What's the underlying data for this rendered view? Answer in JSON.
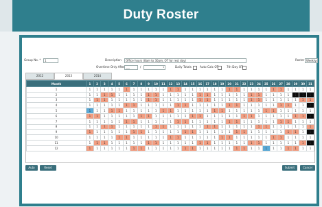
{
  "app": {
    "title": "Duty Roster"
  },
  "form": {
    "group_label": "Group No. *",
    "group_value": "1",
    "description_label": "Description",
    "description_value": "Office hours (8am to 30pm, OT for rest day)",
    "roster_label": "Roster",
    "roster_value": "Weekly",
    "overtime_label": "Overtime Only After",
    "overtime_hours": "___",
    "overtime_sep": "/",
    "daily_totals_label": "Daily Totals",
    "auto_calc_label": "Auto Calc OT",
    "seventh_day_label": "7th Day OT"
  },
  "tabs": [
    "2012",
    "2013",
    "2014"
  ],
  "active_tab": "2013",
  "grid": {
    "month_header": "Month",
    "days": [
      "1",
      "2",
      "3",
      "4",
      "5",
      "6",
      "7",
      "8",
      "9",
      "10",
      "11",
      "12",
      "13",
      "14",
      "15",
      "16",
      "17",
      "18",
      "19",
      "20",
      "21",
      "22",
      "23",
      "24",
      "25",
      "26",
      "27",
      "28",
      "29",
      "30",
      "31"
    ],
    "rows": [
      {
        "month": "1",
        "s": [
          6,
          12,
          13,
          20,
          21,
          26,
          27
        ],
        "b": [],
        "k": []
      },
      {
        "month": "2",
        "s": [
          3,
          4,
          9,
          10,
          16,
          17,
          23,
          24
        ],
        "b": [],
        "k": [
          29,
          30,
          31
        ]
      },
      {
        "month": "3",
        "s": [
          2,
          3,
          9,
          10,
          16,
          17,
          23,
          24,
          30,
          31
        ],
        "b": [],
        "k": []
      },
      {
        "month": "4",
        "s": [
          6,
          7,
          13,
          14,
          20,
          21,
          27,
          28
        ],
        "b": [],
        "k": [
          31
        ]
      },
      {
        "month": "5",
        "s": [
          4,
          5,
          11,
          12,
          18,
          19,
          25,
          26
        ],
        "b": [
          1
        ],
        "k": []
      },
      {
        "month": "6",
        "s": [
          1,
          2,
          8,
          9,
          15,
          16,
          22,
          23,
          29,
          30
        ],
        "b": [],
        "k": [
          31
        ]
      },
      {
        "month": "7",
        "s": [
          6,
          7,
          13,
          14,
          20,
          21,
          27,
          28
        ],
        "b": [],
        "k": []
      },
      {
        "month": "8",
        "s": [
          3,
          4,
          10,
          11,
          17,
          18,
          24,
          25,
          31
        ],
        "b": [],
        "k": []
      },
      {
        "month": "9",
        "s": [
          1,
          7,
          8,
          14,
          15,
          21,
          22,
          28,
          29
        ],
        "b": [],
        "k": [
          31
        ]
      },
      {
        "month": "10",
        "s": [
          5,
          6,
          12,
          13,
          19,
          20,
          26,
          27
        ],
        "b": [],
        "k": []
      },
      {
        "month": "11",
        "s": [
          2,
          3,
          9,
          10,
          16,
          17,
          23,
          24,
          30
        ],
        "b": [],
        "k": [
          31
        ]
      },
      {
        "month": "12",
        "s": [
          1,
          7,
          8,
          14,
          15,
          21,
          22,
          28,
          29
        ],
        "b": [
          25
        ],
        "k": []
      }
    ],
    "cell_value": "1"
  },
  "buttons": {
    "auto": "Auto",
    "reset": "Reset",
    "submit": "Submit",
    "cancel": "Cancel"
  },
  "colors": {
    "header": "#2f7f8d",
    "grid_header": "#3a6f7c",
    "weekend": "#f29e82",
    "holiday": "#5aa9d6",
    "blocked": "#0b0b0b"
  }
}
